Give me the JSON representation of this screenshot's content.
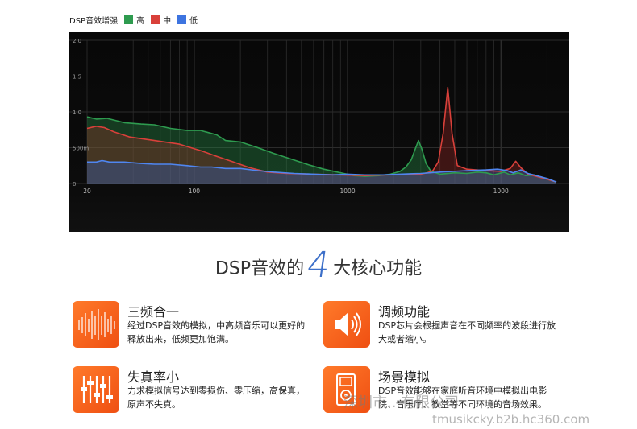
{
  "chart_data": {
    "type": "area",
    "title": "DSP音效增强",
    "legend": [
      {
        "name": "高",
        "color": "#2e9b4f"
      },
      {
        "name": "中",
        "color": "#d9403a"
      },
      {
        "name": "低",
        "color": "#3d74e0"
      }
    ],
    "x_scale": "log",
    "xlim": [
      20,
      1000
    ],
    "ylim": [
      0,
      2.0
    ],
    "x_ticks": [
      {
        "v": 20,
        "label": "20"
      },
      {
        "v": 100,
        "label": "100"
      },
      {
        "v": 1000,
        "label": "1000"
      },
      {
        "v": 10000,
        "label": "1000"
      }
    ],
    "y_ticks": [
      {
        "v": 0,
        "label": "0"
      },
      {
        "v": 0.5,
        "label": "500m"
      },
      {
        "v": 1.0,
        "label": "1,0"
      },
      {
        "v": 1.5,
        "label": "1,5"
      },
      {
        "v": 2.0,
        "label": "2,0"
      }
    ],
    "series": [
      {
        "name": "高",
        "color": "#2e9b4f",
        "fill": "rgba(40,140,70,0.38)",
        "points": [
          [
            20,
            0.93
          ],
          [
            23,
            0.9
          ],
          [
            27,
            0.91
          ],
          [
            35,
            0.85
          ],
          [
            45,
            0.83
          ],
          [
            55,
            0.82
          ],
          [
            70,
            0.77
          ],
          [
            90,
            0.74
          ],
          [
            110,
            0.74
          ],
          [
            140,
            0.68
          ],
          [
            160,
            0.6
          ],
          [
            200,
            0.58
          ],
          [
            260,
            0.5
          ],
          [
            330,
            0.42
          ],
          [
            430,
            0.34
          ],
          [
            560,
            0.26
          ],
          [
            700,
            0.2
          ],
          [
            900,
            0.15
          ],
          [
            1100,
            0.11
          ],
          [
            1300,
            0.1
          ],
          [
            1600,
            0.11
          ],
          [
            1900,
            0.13
          ],
          [
            2200,
            0.17
          ],
          [
            2400,
            0.23
          ],
          [
            2600,
            0.33
          ],
          [
            2750,
            0.47
          ],
          [
            2900,
            0.6
          ],
          [
            3050,
            0.48
          ],
          [
            3250,
            0.28
          ],
          [
            3500,
            0.17
          ],
          [
            4000,
            0.13
          ],
          [
            5000,
            0.15
          ],
          [
            6000,
            0.14
          ],
          [
            7000,
            0.16
          ],
          [
            8000,
            0.15
          ],
          [
            9000,
            0.12
          ],
          [
            10500,
            0.16
          ],
          [
            11500,
            0.12
          ],
          [
            13000,
            0.15
          ],
          [
            14500,
            0.11
          ],
          [
            16500,
            0.12
          ],
          [
            19000,
            0.08
          ],
          [
            23000,
            0.02
          ]
        ]
      },
      {
        "name": "中",
        "color": "#d9403a",
        "fill": "rgba(170,45,40,0.32)",
        "points": [
          [
            20,
            0.77
          ],
          [
            23,
            0.8
          ],
          [
            26,
            0.78
          ],
          [
            30,
            0.72
          ],
          [
            38,
            0.65
          ],
          [
            55,
            0.6
          ],
          [
            80,
            0.55
          ],
          [
            95,
            0.5
          ],
          [
            110,
            0.46
          ],
          [
            140,
            0.38
          ],
          [
            180,
            0.3
          ],
          [
            230,
            0.22
          ],
          [
            300,
            0.16
          ],
          [
            400,
            0.14
          ],
          [
            600,
            0.13
          ],
          [
            900,
            0.12
          ],
          [
            1300,
            0.11
          ],
          [
            1800,
            0.12
          ],
          [
            2400,
            0.13
          ],
          [
            3000,
            0.13
          ],
          [
            3300,
            0.15
          ],
          [
            3600,
            0.18
          ],
          [
            3900,
            0.3
          ],
          [
            4200,
            0.7
          ],
          [
            4500,
            1.34
          ],
          [
            4800,
            0.7
          ],
          [
            5200,
            0.25
          ],
          [
            6000,
            0.2
          ],
          [
            8000,
            0.18
          ],
          [
            10000,
            0.17
          ],
          [
            11500,
            0.21
          ],
          [
            12500,
            0.31
          ],
          [
            13500,
            0.22
          ],
          [
            15000,
            0.13
          ],
          [
            17000,
            0.1
          ],
          [
            20000,
            0.06
          ],
          [
            23000,
            0.02
          ]
        ]
      },
      {
        "name": "低",
        "color": "#4f86f0",
        "fill": "rgba(50,100,200,0.34)",
        "points": [
          [
            20,
            0.3
          ],
          [
            23,
            0.3
          ],
          [
            25,
            0.32
          ],
          [
            28,
            0.3
          ],
          [
            35,
            0.3
          ],
          [
            45,
            0.28
          ],
          [
            55,
            0.27
          ],
          [
            70,
            0.27
          ],
          [
            90,
            0.25
          ],
          [
            110,
            0.23
          ],
          [
            130,
            0.23
          ],
          [
            160,
            0.21
          ],
          [
            200,
            0.21
          ],
          [
            260,
            0.18
          ],
          [
            330,
            0.16
          ],
          [
            450,
            0.14
          ],
          [
            600,
            0.13
          ],
          [
            800,
            0.12
          ],
          [
            1000,
            0.13
          ],
          [
            1300,
            0.12
          ],
          [
            1700,
            0.12
          ],
          [
            2200,
            0.13
          ],
          [
            3000,
            0.14
          ],
          [
            4000,
            0.16
          ],
          [
            6000,
            0.18
          ],
          [
            8000,
            0.19
          ],
          [
            9500,
            0.2
          ],
          [
            11000,
            0.18
          ],
          [
            12000,
            0.15
          ],
          [
            13500,
            0.19
          ],
          [
            15000,
            0.14
          ],
          [
            17000,
            0.11
          ],
          [
            20000,
            0.07
          ],
          [
            23000,
            0.02
          ]
        ]
      }
    ]
  },
  "heading": {
    "before": "DSP音效的",
    "number": "4",
    "after": "大核心功能"
  },
  "features": [
    {
      "title": "三频合一",
      "desc": "经过DSP音效的模拟，中高频音乐可以更好的释放出来，低频更加饱满。",
      "icon": "waveform-icon"
    },
    {
      "title": "调频功能",
      "desc": "DSP芯片会根据声音在不同频率的波段进行放大或者缩小。",
      "icon": "speaker-icon"
    },
    {
      "title": "失真率小",
      "desc": "力求模拟信号达到零损伤、零压缩，高保真，原声不失真。",
      "icon": "equalizer-sliders-icon"
    },
    {
      "title": "场景模拟",
      "desc": "DSP音效能够在家庭听音环境中模拟出电影院、音乐厅、教堂等不同环境的音场效果。",
      "icon": "player-device-icon"
    }
  ],
  "watermark": {
    "line1": "深圳市...有限公司",
    "line2": "tmusikcky.b2b.hc360.com"
  }
}
